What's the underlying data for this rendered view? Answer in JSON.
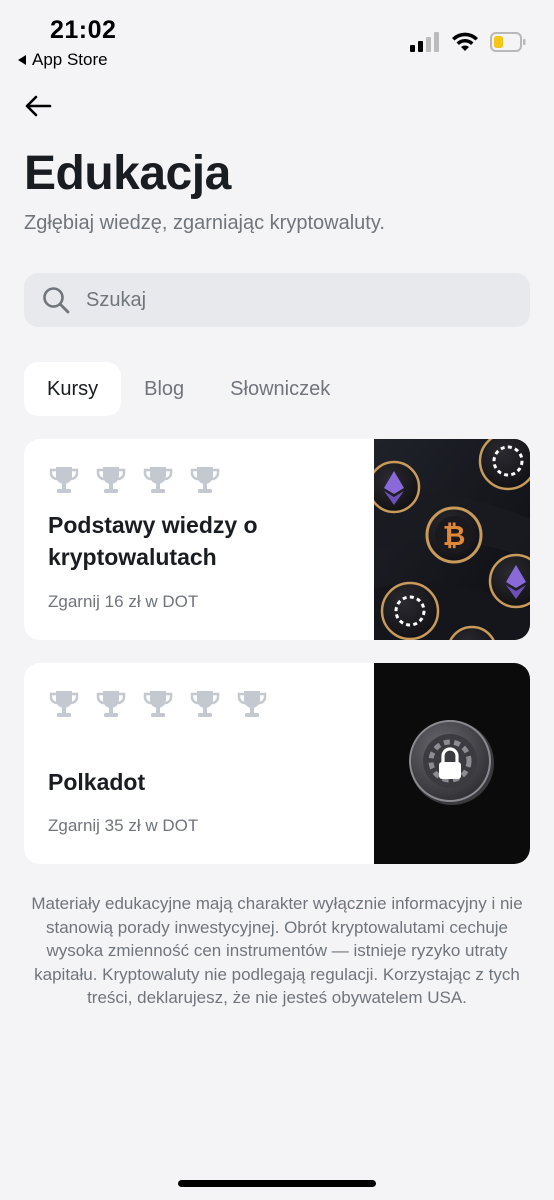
{
  "status_bar": {
    "time": "21:02",
    "back_app": "App Store",
    "icons": [
      "cellular-signal-icon",
      "wifi-icon",
      "battery-low-icon"
    ]
  },
  "header": {
    "back_icon": "arrow-left-icon",
    "title": "Edukacja",
    "subtitle": "Zgłębiaj wiedzę, zgarniając kryptowaluty."
  },
  "search": {
    "placeholder": "Szukaj",
    "value": "",
    "icon": "search-icon"
  },
  "tabs": [
    {
      "label": "Kursy",
      "active": true
    },
    {
      "label": "Blog",
      "active": false
    },
    {
      "label": "Słowniczek",
      "active": false
    }
  ],
  "courses": [
    {
      "trophy_count": 4,
      "title": "Podstawy wiedzy o kryptowalutach",
      "reward": "Zgarnij 16 zł w DOT",
      "image": "crypto-coins-illustration"
    },
    {
      "trophy_count": 5,
      "title": "Polkadot",
      "reward": "Zgarnij 35 zł w DOT",
      "image": "locked-polkadot-coin-illustration"
    }
  ],
  "disclaimer": "Materiały edukacyjne mają charakter wyłącznie informacyjny i nie stanowią porady inwestycyjnej. Obrót kryptowalutami cechuje wysoka zmienność cen instrumentów — istnieje ryzyko utraty kapitału. Kryptowaluty nie podlegają regulacji. Korzystając z tych treści, deklarujesz, że nie jesteś obywatelem USA.",
  "colors": {
    "background": "#f4f4f6",
    "card": "#ffffff",
    "text_primary": "#191c20",
    "text_secondary": "#70757c",
    "trophy": "#c4c8d0",
    "battery": "#f5c518"
  }
}
